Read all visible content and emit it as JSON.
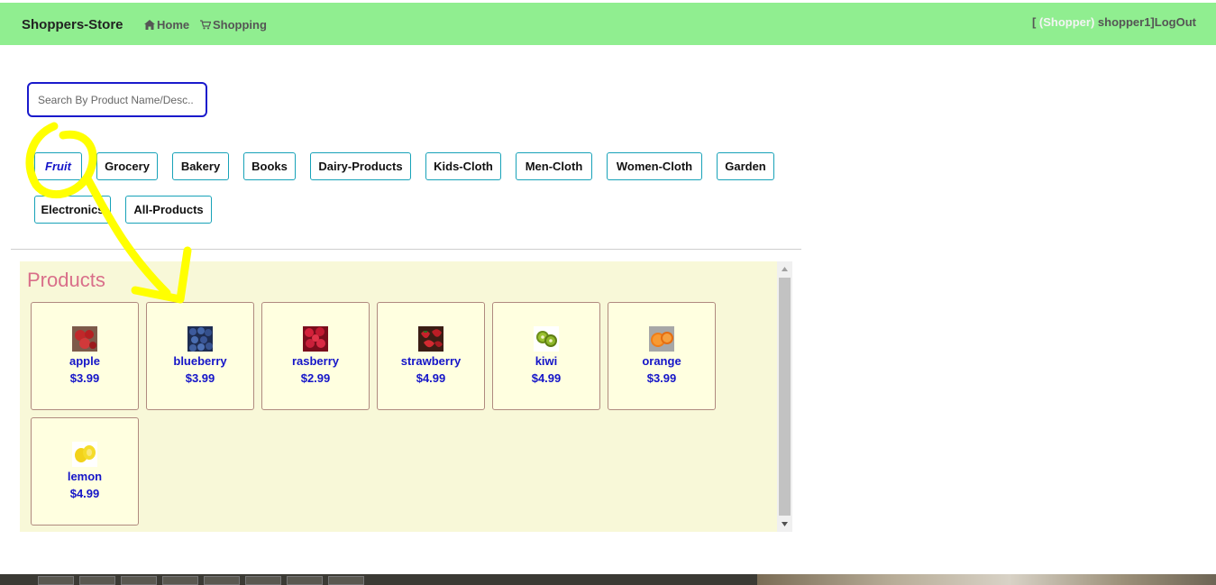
{
  "navbar": {
    "brand": "Shoppers-Store",
    "links": [
      {
        "label": "Home",
        "icon": "home-icon"
      },
      {
        "label": "Shopping",
        "icon": "cart-icon"
      }
    ],
    "user": {
      "open": "[ ",
      "role": "(Shopper)",
      "name": " shopper1]",
      "logout": "LogOut"
    },
    "bg_color": "#90ee90"
  },
  "search": {
    "placeholder": "Search By Product Name/Desc.."
  },
  "categories": [
    {
      "label": "Fruit",
      "active": true
    },
    {
      "label": "Grocery"
    },
    {
      "label": "Bakery"
    },
    {
      "label": "Books"
    },
    {
      "label": "Dairy-Products"
    },
    {
      "label": "Kids-Cloth"
    },
    {
      "label": "Men-Cloth"
    },
    {
      "label": "Women-Cloth"
    },
    {
      "label": "Garden"
    },
    {
      "label": "Electronics"
    },
    {
      "label": "All-Products"
    }
  ],
  "products": {
    "title": "Products",
    "items": [
      {
        "name": "apple",
        "price": "$3.99"
      },
      {
        "name": "blueberry",
        "price": "$3.99"
      },
      {
        "name": "rasberry",
        "price": "$2.99"
      },
      {
        "name": "strawberry",
        "price": "$4.99"
      },
      {
        "name": "kiwi",
        "price": "$4.99"
      },
      {
        "name": "orange",
        "price": "$3.99"
      },
      {
        "name": "lemon",
        "price": "$4.99"
      }
    ]
  },
  "colors": {
    "accent_blue": "#1515c8",
    "title_pink": "#d96f8a",
    "panel_bg": "#f8f8d8",
    "card_bg": "#ffffe0",
    "button_border": "#17a2b8",
    "annotation_yellow": "#ffff00"
  }
}
